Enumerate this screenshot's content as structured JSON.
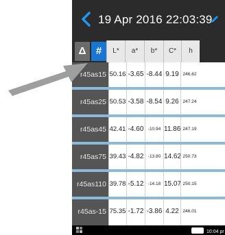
{
  "header": {
    "title": "19 Apr 2016 22:03:39"
  },
  "mode_buttons": {
    "delta": "Δ",
    "hash": "#"
  },
  "columns": [
    "L*",
    "a*",
    "b*",
    "C*",
    "h"
  ],
  "rows": [
    {
      "name": "r45as15",
      "L": "50.16",
      "a": "-3.65",
      "b": "-8.44",
      "C": "9.19",
      "h": "246.62"
    },
    {
      "name": "r45as25",
      "L": "50.53",
      "a": "-3.58",
      "b": "-8.54",
      "C": "9.26",
      "h": "247.24"
    },
    {
      "name": "r45as45",
      "L": "42.41",
      "a": "-4.60",
      "b": "-10.94",
      "C": "11.86",
      "h": "247.19"
    },
    {
      "name": "r45as75",
      "L": "39.43",
      "a": "-4.82",
      "b": "-13.80",
      "C": "14.62",
      "h": "250.73"
    },
    {
      "name": "r45as110",
      "L": "39.78",
      "a": "-5.12",
      "b": "-14.18",
      "C": "15.07",
      "h": "250.15"
    },
    {
      "name": "r45as-15",
      "L": "75.35",
      "a": "-1.72",
      "b": "-3.86",
      "C": "4.22",
      "h": "246.01"
    }
  ],
  "statusbar": {
    "time": "10:04 pr"
  },
  "colors": {
    "accent": "#1976d2",
    "background": "#2b2b2b",
    "row_separator": "#8fb7d9"
  }
}
